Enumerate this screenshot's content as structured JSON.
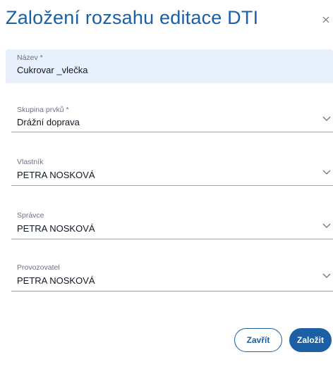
{
  "dialog": {
    "title": "Založení rozsahu editace DTI",
    "close_icon": "close-icon"
  },
  "fields": {
    "nazev": {
      "label": "Název *",
      "value": "Cukrovar _vlečka"
    },
    "skupina": {
      "label": "Skupina prvků *",
      "value": "Drážní doprava",
      "icon": "chevron-down-icon"
    },
    "vlastnik": {
      "label": "Vlastník",
      "value": "PETRA NOSKOVÁ",
      "icon": "chevron-down-icon"
    },
    "spravce": {
      "label": "Správce",
      "value": "PETRA NOSKOVÁ",
      "icon": "chevron-down-icon"
    },
    "provozovatel": {
      "label": "Provozovatel",
      "value": "PETRA NOSKOVÁ",
      "icon": "chevron-down-icon"
    }
  },
  "buttons": {
    "close_label": "Zavřít",
    "create_label": "Založit"
  },
  "colors": {
    "accent": "#1b5fa4",
    "filled_field_bg": "#e8f0fb"
  }
}
